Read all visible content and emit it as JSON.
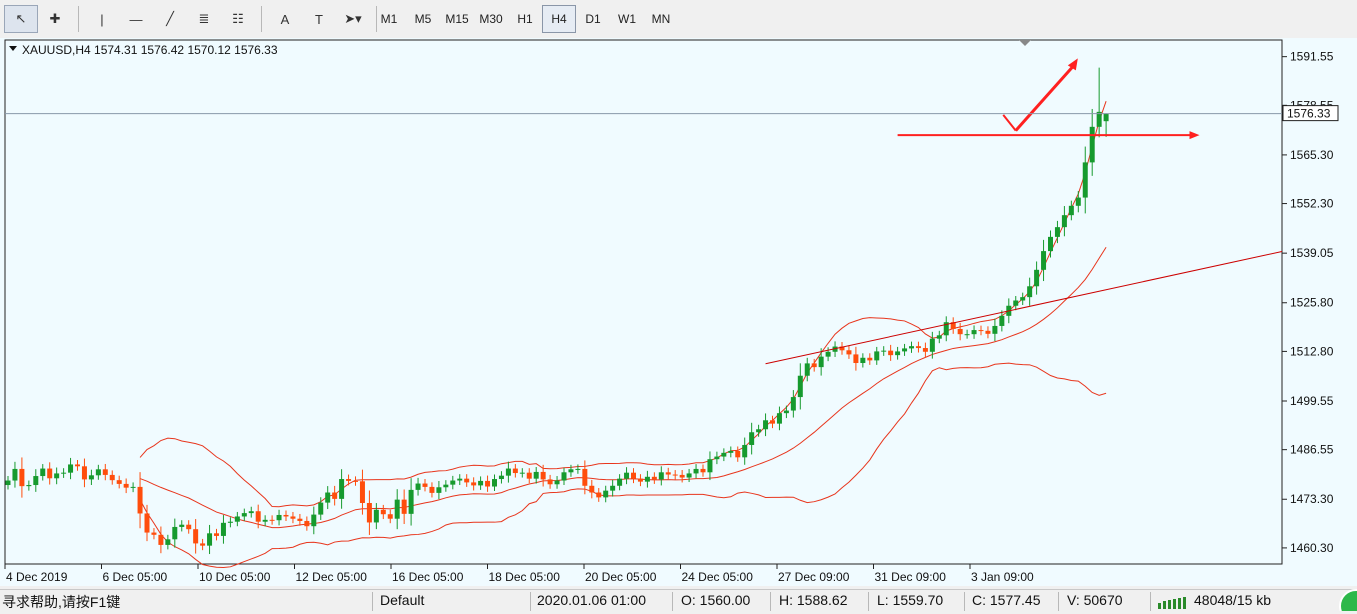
{
  "toolbar": {
    "tools": [
      {
        "name": "cursor-tool-button",
        "glyph": "↖",
        "active": true
      },
      {
        "name": "crosshair-tool-button",
        "glyph": "✚",
        "active": false
      },
      {
        "name": "vertical-line-tool-button",
        "glyph": "|",
        "active": false
      },
      {
        "name": "horizontal-line-tool-button",
        "glyph": "—",
        "active": false
      },
      {
        "name": "trendline-tool-button",
        "glyph": "╱",
        "active": false
      },
      {
        "name": "equidistant-channel-tool-button",
        "glyph": "≣",
        "active": false
      },
      {
        "name": "fibonacci-tool-button",
        "glyph": "☷",
        "active": false
      },
      {
        "name": "text-tool-button",
        "glyph": "A",
        "active": false
      },
      {
        "name": "text-label-tool-button",
        "glyph": "T",
        "active": false
      },
      {
        "name": "arrows-tool-button",
        "glyph": "➤▾",
        "active": false
      }
    ],
    "timeframes": [
      {
        "label": "M1",
        "active": false
      },
      {
        "label": "M5",
        "active": false
      },
      {
        "label": "M15",
        "active": false
      },
      {
        "label": "M30",
        "active": false
      },
      {
        "label": "H1",
        "active": false
      },
      {
        "label": "H4",
        "active": true
      },
      {
        "label": "D1",
        "active": false
      },
      {
        "label": "W1",
        "active": false
      },
      {
        "label": "MN",
        "active": false
      }
    ]
  },
  "chart": {
    "header_text": "XAUUSD,H4  1574.31 1576.42 1570.12 1576.33",
    "current_price_label": "1576.33",
    "price_axis_labels": [
      "1591.55",
      "1578.55",
      "1565.30",
      "1552.30",
      "1539.05",
      "1525.80",
      "1512.80",
      "1499.55",
      "1486.55",
      "1473.30",
      "1460.30"
    ],
    "time_axis_labels": [
      "4 Dec 2019",
      "6 Dec 05:00",
      "10 Dec 05:00",
      "12 Dec 05:00",
      "16 Dec 05:00",
      "18 Dec 05:00",
      "20 Dec 05:00",
      "24 Dec 05:00",
      "27 Dec 09:00",
      "31 Dec 09:00",
      "3 Jan 09:00"
    ],
    "colors": {
      "background": "#f0fbff",
      "bull": "#169a2e",
      "bear": "#ff4d0c",
      "bands": "#e8351c",
      "annotation": "#ff2020",
      "trendline": "#cc0000",
      "price_line": "#8899aa"
    }
  },
  "chart_data": {
    "type": "candlestick",
    "symbol": "XAUUSD",
    "timeframe": "H4",
    "ylim": [
      1456.0,
      1596.0
    ],
    "last_price": 1576.33,
    "ohlc_last": {
      "open": 1574.31,
      "high": 1576.42,
      "low": 1570.12,
      "close": 1576.33
    },
    "closes": [
      1478.3,
      1481.4,
      1476.8,
      1477.1,
      1479.5,
      1481.5,
      1478.9,
      1480.2,
      1480.4,
      1482.6,
      1482.1,
      1478.6,
      1479.7,
      1481.3,
      1479.8,
      1478.4,
      1477.4,
      1476.4,
      1476.6,
      1469.5,
      1464.4,
      1463.8,
      1461.1,
      1462.6,
      1465.9,
      1466.5,
      1465.3,
      1461.5,
      1460.9,
      1464.2,
      1463.5,
      1467.0,
      1467.3,
      1468.7,
      1469.6,
      1470.1,
      1467.3,
      1467.8,
      1467.7,
      1469.1,
      1468.7,
      1468.1,
      1467.5,
      1466.1,
      1469.2,
      1472.4,
      1475.1,
      1473.4,
      1478.7,
      1478.2,
      1478.1,
      1472.3,
      1467.1,
      1470.5,
      1469.3,
      1468.1,
      1473.2,
      1469.4,
      1475.8,
      1477.5,
      1476.6,
      1475.0,
      1476.5,
      1477.2,
      1478.3,
      1478.8,
      1477.8,
      1477.0,
      1478.2,
      1476.7,
      1478.7,
      1479.6,
      1481.5,
      1480.3,
      1480.4,
      1478.8,
      1480.6,
      1478.6,
      1477.3,
      1478.3,
      1480.5,
      1481.3,
      1481.4,
      1476.9,
      1475.1,
      1473.8,
      1475.6,
      1476.9,
      1478.8,
      1480.4,
      1478.8,
      1478.0,
      1479.3,
      1478.6,
      1480.5,
      1479.9,
      1479.8,
      1479.1,
      1480.2,
      1481.4,
      1480.5,
      1484.0,
      1484.7,
      1485.7,
      1486.2,
      1484.5,
      1487.8,
      1491.2,
      1492.0,
      1494.4,
      1493.5,
      1496.3,
      1497.0,
      1500.6,
      1506.3,
      1509.6,
      1508.6,
      1511.4,
      1512.7,
      1514.1,
      1513.1,
      1512.0,
      1509.7,
      1511.1,
      1510.4,
      1512.8,
      1513.0,
      1511.8,
      1512.8,
      1513.6,
      1514.2,
      1513.7,
      1512.7,
      1516.2,
      1517.1,
      1520.6,
      1518.8,
      1517.4,
      1517.4,
      1518.5,
      1518.3,
      1517.5,
      1519.6,
      1522.3,
      1525.0,
      1526.4,
      1527.3,
      1530.2,
      1534.6,
      1539.6,
      1543.4,
      1546.0,
      1549.2,
      1551.7,
      1553.9,
      1563.3,
      1572.8,
      1576.8,
      1576.3
    ],
    "series": [
      {
        "name": "Bollinger upper"
      },
      {
        "name": "Bollinger middle"
      },
      {
        "name": "Bollinger lower"
      }
    ]
  },
  "statusbar": {
    "help_text": "寻求帮助,请按F1键",
    "profile": "Default",
    "datetime": "2020.01.06 01:00",
    "open": "O: 1560.00",
    "high": "H: 1588.62",
    "low": "L: 1559.70",
    "close": "C: 1577.45",
    "volume": "V: 50670",
    "traffic": "48048/15 kb"
  }
}
